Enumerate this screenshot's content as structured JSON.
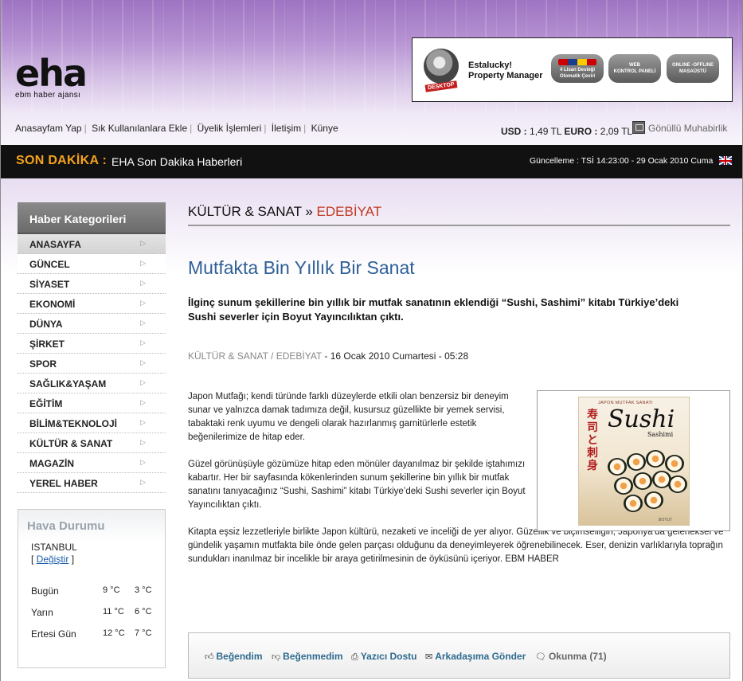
{
  "header": {
    "logo_text": "eha",
    "logo_subtext": "ebm haber ajansı",
    "ad": {
      "badge": "DESKTOP",
      "title_line1": "Estalucky!",
      "title_line2": "Property Manager",
      "pill1_line1": "4 Lisan Desteği",
      "pill1_line2": "Otomatik Çeviri",
      "pill2_line1": "WEB",
      "pill2_line2": "KONTROL PANELİ",
      "pill3_line1": "ONLINE -OFFLINE",
      "pill3_line2": "MASAÜSTÜ"
    },
    "top_links": [
      "Anasayfam Yap",
      "Sık Kullanılanlara Ekle",
      "Üyelik İşlemleri",
      "İletişim",
      "Künye"
    ],
    "currency": {
      "usd_label": "USD :",
      "usd_value": "1,49 TL",
      "euro_label": "EURO :",
      "euro_value": "2,09 TL"
    },
    "volunteer_link": "Gönüllü Muhabirlik"
  },
  "breaking": {
    "label": "SON DAKİKA :",
    "text": "EHA Son Dakika Haberleri",
    "updated": "Güncelleme : TSİ 14:23:00 - 29 Ocak 2010 Cuma"
  },
  "sidebar": {
    "title": "Haber Kategorileri",
    "items": [
      "ANASAYFA",
      "GÜNCEL",
      "SİYASET",
      "EKONOMİ",
      "DÜNYA",
      "ŞİRKET",
      "SPOR",
      "SAĞLIK&YAŞAM",
      "EĞİTİM",
      "BİLİM&TEKNOLOJİ",
      "KÜLTÜR & SANAT",
      "MAGAZİN",
      "YEREL HABER"
    ]
  },
  "weather": {
    "title": "Hava Durumu",
    "city": "ISTANBUL",
    "change_prefix": "[ ",
    "change_link": "Değiştir",
    "change_suffix": " ]",
    "rows": [
      {
        "day": "Bugün",
        "hi": "9 °C",
        "lo": "3 °C"
      },
      {
        "day": "Yarın",
        "hi": "11 °C",
        "lo": "6 °C"
      },
      {
        "day": "Ertesi Gün",
        "hi": "12 °C",
        "lo": "7 °C"
      }
    ]
  },
  "article": {
    "crumb_main": "KÜLTÜR & SANAT",
    "crumb_sep": " » ",
    "crumb_sub": "EDEBİYAT",
    "title": "Mutfakta Bin Yıllık Bir Sanat",
    "lead": "İlginç sunum şekillerine bin yıllık bir mutfak sanatının eklendiği “Sushi, Sashimi” kitabı Türkiye’deki Sushi severler için Boyut Yayıncılıktan çıktı.",
    "meta_category": "KÜLTÜR & SANAT / EDEBİYAT",
    "meta_date": " - 16 Ocak 2010 Cumartesi - 05:28",
    "p1": "Japon Mutfağı; kendi türünde farklı düzeylerde etkili olan benzersiz bir deneyim sunar ve yalnızca damak tadımıza değil, kusursuz güzellikte bir yemek servisi, tabaktaki renk uyumu ve dengeli olarak hazırlanmış garnitürlerle estetik beğenilerimize de hitap eder.",
    "p2": "Güzel görünüşüyle gözümüze hitap eden mönüler dayanılmaz bir şekilde iştahımızı kabartır. Her bir sayfasında kökenlerinden sunum şekillerine bin yıllık bir mutfak sanatını tanıyacağınız “Sushi, Sashimi” kitabı Türkiye’deki Sushi severler için Boyut Yayıncılıktan çıktı.",
    "p3": "Kitapta eşsiz lezzetleriyle birlikte Japon kültürü, nezaketi ve inceliği de yer alıyor. Güzellik ve biçimselliğin, Japonya’da geleneksel ve gündelik yaşamın mutfakta bile önde gelen parçası olduğunu da deneyimleyerek öğrenebilinecek. Eser, denizin varlıklarıyla toprağın sundukları inanılmaz bir incelikle bir araya getirilmesinin de öyküsünü içeriyor. EBM HABER",
    "book": {
      "header": "JAPON MUTFAK SANATI",
      "kanji": "寿司と刺身",
      "title": "Sushi",
      "subtitle": "Sashimi",
      "publisher": "BOYUT"
    }
  },
  "tools": {
    "like": "Beğendim",
    "dislike": "Beğenmedim",
    "print": "Yazıcı Dostu",
    "send": "Arkadaşıma Gönder",
    "reads": "Okunma (71)"
  }
}
